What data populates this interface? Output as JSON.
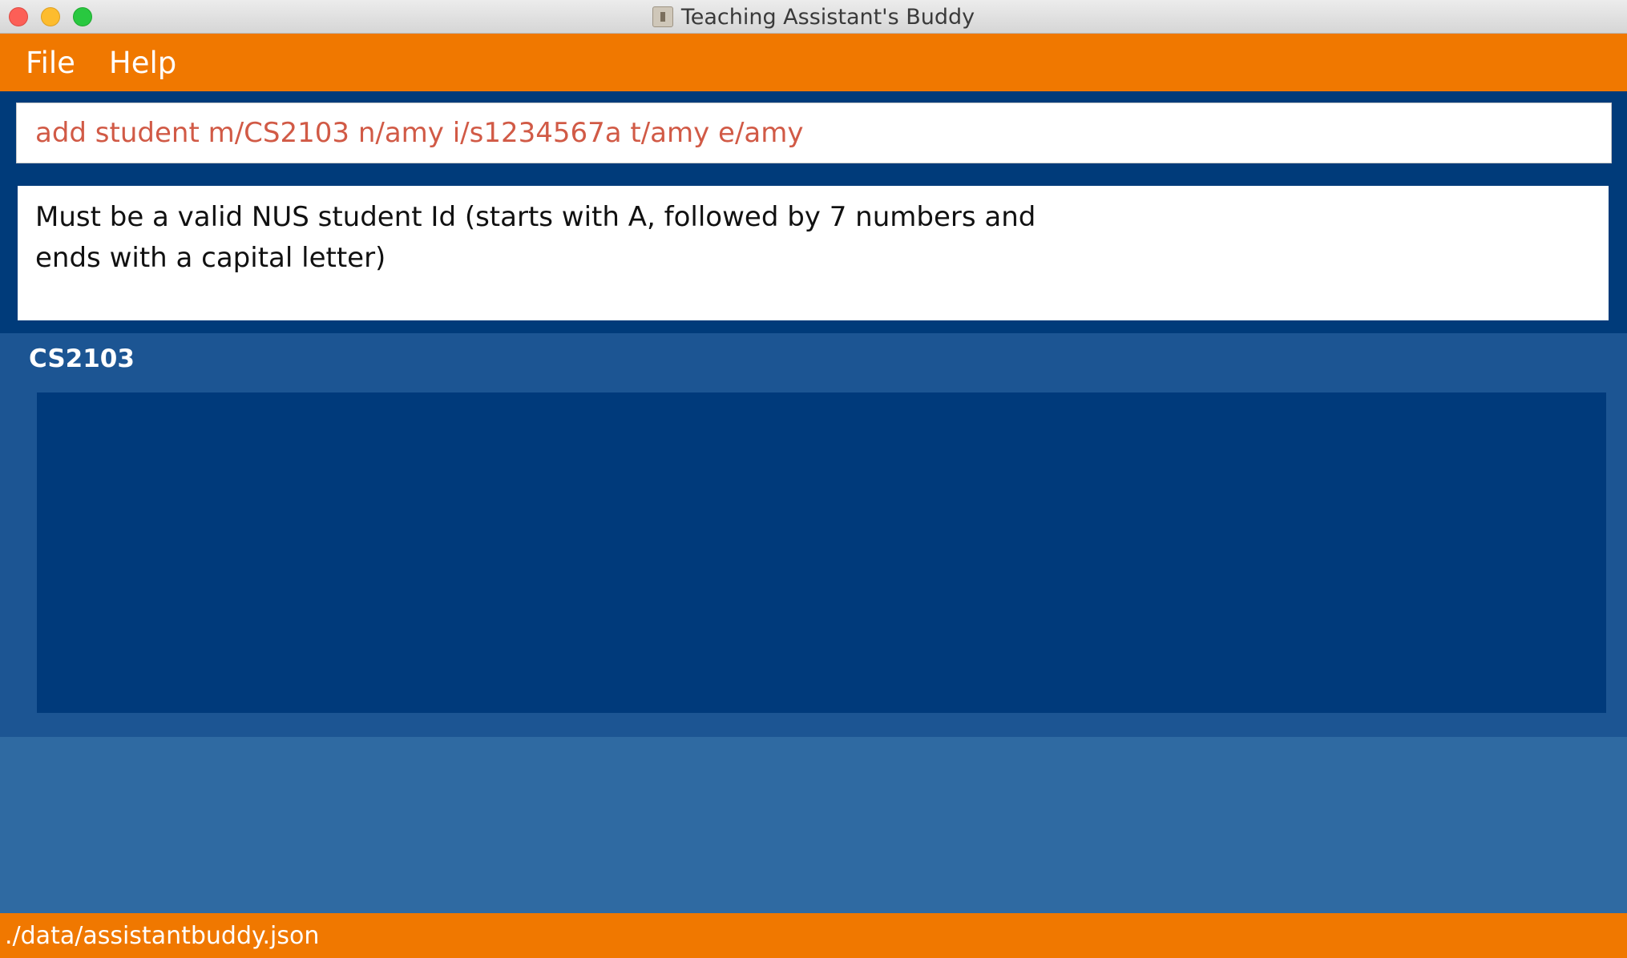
{
  "window": {
    "title": "Teaching Assistant's Buddy"
  },
  "menu": {
    "items": [
      {
        "label": "File"
      },
      {
        "label": "Help"
      }
    ]
  },
  "command": {
    "value": "add student m/CS2103 n/amy i/s1234567a t/amy e/amy"
  },
  "result": {
    "message": "Must be a valid NUS student Id (starts with A, followed by 7 numbers and ends with a capital letter)"
  },
  "module": {
    "code": "CS2103",
    "students": []
  },
  "status": {
    "file_path": "./data/assistantbuddy.json"
  },
  "colors": {
    "accent": "#f07800",
    "dark_blue": "#003b7a",
    "panel_blue": "#1c5593",
    "background_blue": "#2f6aa2",
    "command_text": "#d15a46"
  }
}
